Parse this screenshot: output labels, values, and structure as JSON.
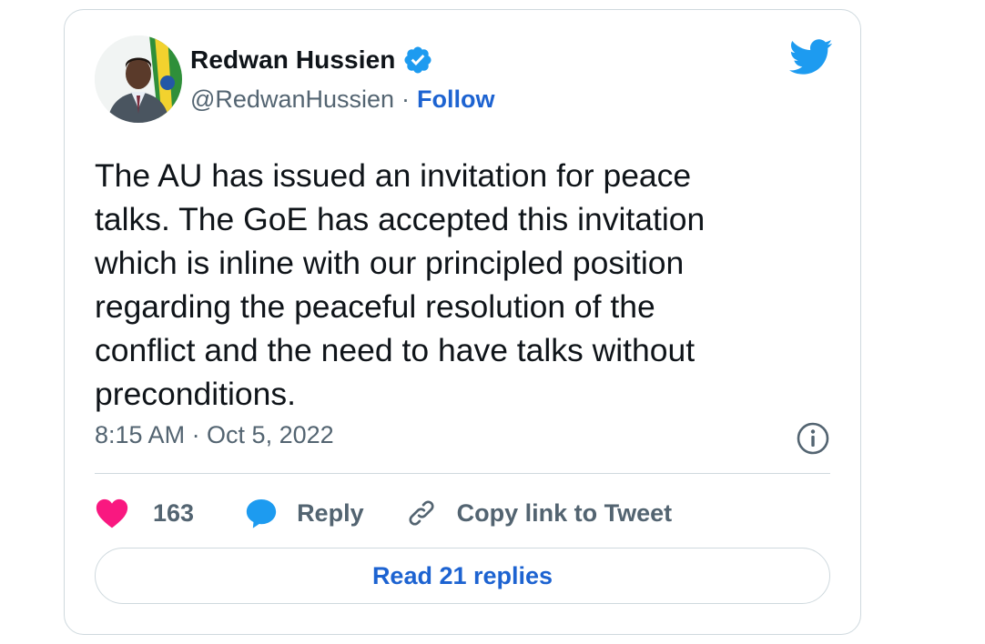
{
  "author": {
    "display_name": "Redwan Hussien",
    "handle": "@RedwanHussien",
    "separator": "·",
    "follow_label": "Follow",
    "verified": true
  },
  "icons": {
    "avatar": "profile-photo",
    "verified": "verified-badge-icon",
    "brand": "twitter-bird-icon",
    "info": "info-icon",
    "like": "heart-icon",
    "reply": "speech-bubble-icon",
    "copy": "link-icon"
  },
  "tweet": {
    "text": "The AU has issued an invitation for peace\ntalks. The GoE has accepted this invitation\nwhich is inline with our principled position\nregarding the peaceful resolution of the\nconflict and the need to have talks without\npreconditions.",
    "timestamp": "8:15 AM · Oct 5, 2022"
  },
  "actions": {
    "like_count": "163",
    "reply_label": "Reply",
    "copy_label": "Copy link to Tweet"
  },
  "footer": {
    "read_replies_label": "Read 21 replies"
  },
  "colors": {
    "link_blue": "#1d63d1",
    "twitter_blue": "#1d9bf0",
    "like_pink": "#f91880",
    "muted_text": "#536471",
    "border": "#cfd9de"
  }
}
